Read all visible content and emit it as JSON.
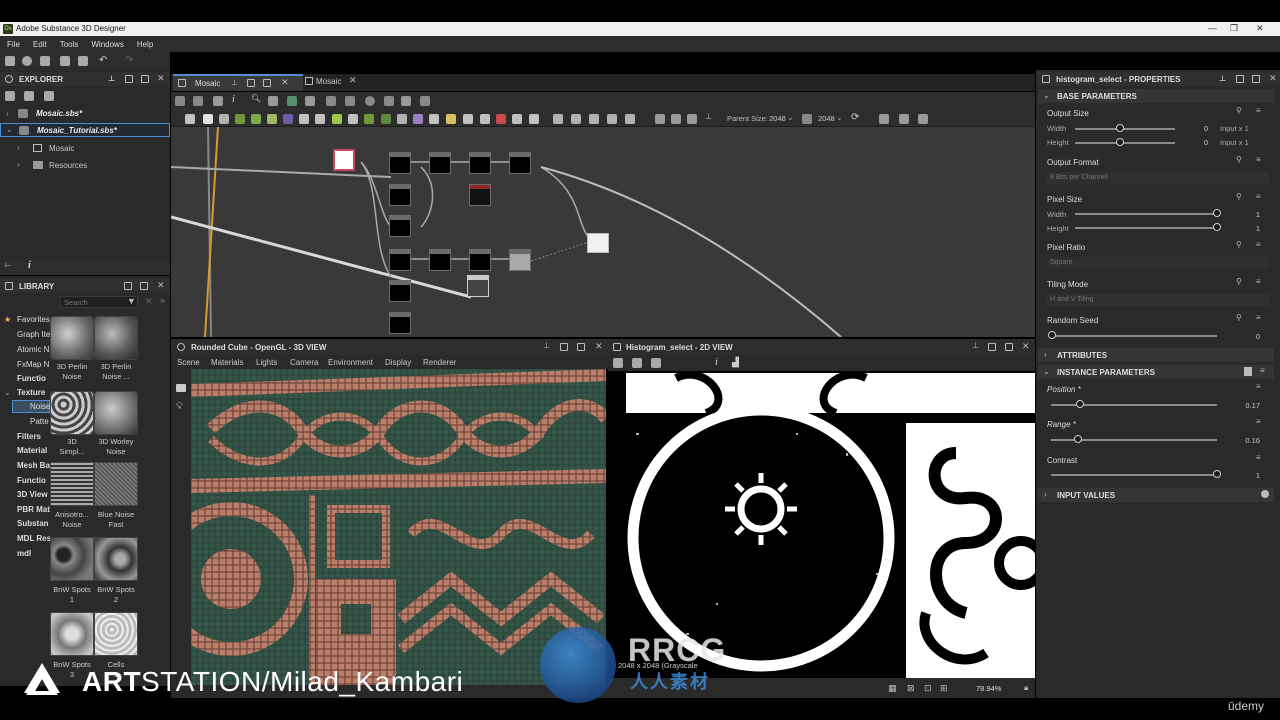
{
  "window": {
    "title": "Adobe Substance 3D Designer",
    "logo": "Ds"
  },
  "menu": [
    "File",
    "Edit",
    "Tools",
    "Windows",
    "Help"
  ],
  "explorer": {
    "title": "EXPLORER",
    "packages": [
      "Mosaic.sbs*",
      "Mosaic_Tutorial.sbs*"
    ],
    "children": [
      "Mosaic",
      "Resources"
    ]
  },
  "library": {
    "title": "LIBRARY",
    "search_placeholder": "Search",
    "categories": [
      "Favorites",
      "Graph Ite",
      "Atomic N",
      "FxMap N",
      "Functio",
      "Texture",
      "Noise",
      "Patte",
      "Filters",
      "Material",
      "Mesh Ba",
      "Functio",
      "3D View",
      "PBR Mat",
      "Substan",
      "MDL Res",
      "mdl"
    ],
    "items": [
      {
        "label1": "3D Perlin",
        "label2": "Noise"
      },
      {
        "label1": "3D Perlin",
        "label2": "Noise ..."
      },
      {
        "label1": "3D",
        "label2": "Simpl..."
      },
      {
        "label1": "3D Worley",
        "label2": "Noise"
      },
      {
        "label1": "Anisotro...",
        "label2": "Noise"
      },
      {
        "label1": "Blue Noise",
        "label2": "Fast"
      },
      {
        "label1": "BnW Spots",
        "label2": "1"
      },
      {
        "label1": "BnW Spots",
        "label2": "2"
      },
      {
        "label1": "BnW Spots",
        "label2": "3"
      },
      {
        "label1": "Cells",
        "label2": "1"
      }
    ]
  },
  "graph": {
    "tabs": [
      "Mosaic",
      "Mosaic"
    ],
    "parent_size_label": "Parent Size:",
    "parent_size": "2048",
    "size": "2048"
  },
  "view3d": {
    "title": "Rounded Cube - OpenGL - 3D VIEW",
    "menu": [
      "Scene",
      "Materials",
      "Lights",
      "Camera",
      "Environment",
      "Display",
      "Renderer"
    ]
  },
  "view2d": {
    "title": "Histogram_select - 2D VIEW",
    "info": "2048 x 2048 (Grayscale",
    "zoom": "78.94%"
  },
  "properties": {
    "title": "histogram_select - PROPERTIES",
    "base": "BASE PARAMETERS",
    "output_size": "Output Size",
    "width": "Width",
    "height": "Height",
    "width_val": "0",
    "height_val": "0",
    "width_unit": "Input x 1",
    "height_unit": "Input x 1",
    "output_format": "Output Format",
    "output_format_val": "8 Bits per Channel",
    "pixel_size": "Pixel Size",
    "px_width_val": "1",
    "px_height_val": "1",
    "pixel_ratio": "Pixel Ratio",
    "pixel_ratio_val": "Square",
    "tiling_mode": "Tiling Mode",
    "tiling_val": "H and V Tiling",
    "random_seed": "Random Seed",
    "random_seed_val": "0",
    "attributes": "ATTRIBUTES",
    "instance": "INSTANCE PARAMETERS",
    "position": "Position *",
    "position_val": "0.17",
    "range": "Range *",
    "range_val": "0.16",
    "contrast": "Contrast",
    "contrast_val": "1",
    "input_values": "INPUT VALUES"
  },
  "watermarks": {
    "artstation": "ART",
    "artstation2": "STATION/Milad_Kambari",
    "rrcg": "RRCG",
    "rrcg_sub": "人人素材",
    "udemy": "ūdemy"
  },
  "colors": {
    "accent": "#f0a030",
    "panel": "#2d2d2d",
    "graph_bg": "#393939"
  }
}
